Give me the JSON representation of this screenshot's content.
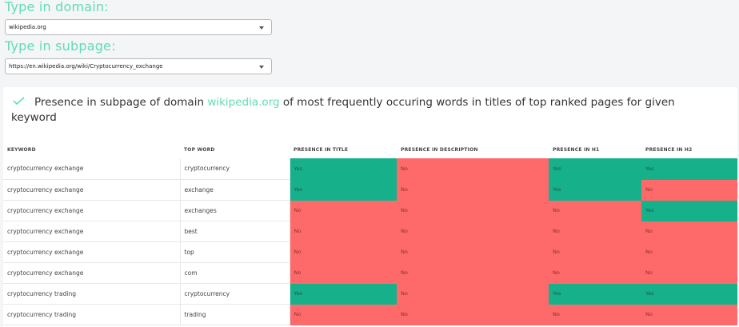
{
  "domain_label": "Type in domain:",
  "domain_value": "wikipedia.org",
  "subpage_label": "Type in subpage:",
  "subpage_value": "https://en.wikipedia.org/wiki/Cryptocurrency_exchange",
  "heading": {
    "prefix": "Presence in subpage of domain",
    "domain": "wikipedia.org",
    "suffix": "of most frequently occuring words in titles of top ranked pages for given keyword"
  },
  "colors": {
    "accent": "#5fdcb6",
    "yes": "#16b08a",
    "no": "#fe6a6a"
  },
  "table": {
    "headers": [
      "KEYWORD",
      "TOP WORD",
      "PRESENCE IN TITLE",
      "PRESENCE IN DESCRIPTION",
      "PRESENCE IN H1",
      "PRESENCE IN H2"
    ],
    "rows": [
      [
        "cryptocurrency exchange",
        "cryptocurrency",
        "Yes",
        "No",
        "Yes",
        "Yes"
      ],
      [
        "cryptocurrency exchange",
        "exchange",
        "Yes",
        "No",
        "Yes",
        "No"
      ],
      [
        "cryptocurrency exchange",
        "exchanges",
        "No",
        "No",
        "No",
        "Yes"
      ],
      [
        "cryptocurrency exchange",
        "best",
        "No",
        "No",
        "No",
        "No"
      ],
      [
        "cryptocurrency exchange",
        "top",
        "No",
        "No",
        "No",
        "No"
      ],
      [
        "cryptocurrency exchange",
        "com",
        "No",
        "No",
        "No",
        "No"
      ],
      [
        "cryptocurrency trading",
        "cryptocurrency",
        "Yes",
        "No",
        "Yes",
        "Yes"
      ],
      [
        "cryptocurrency trading",
        "trading",
        "No",
        "No",
        "No",
        "No"
      ]
    ]
  }
}
